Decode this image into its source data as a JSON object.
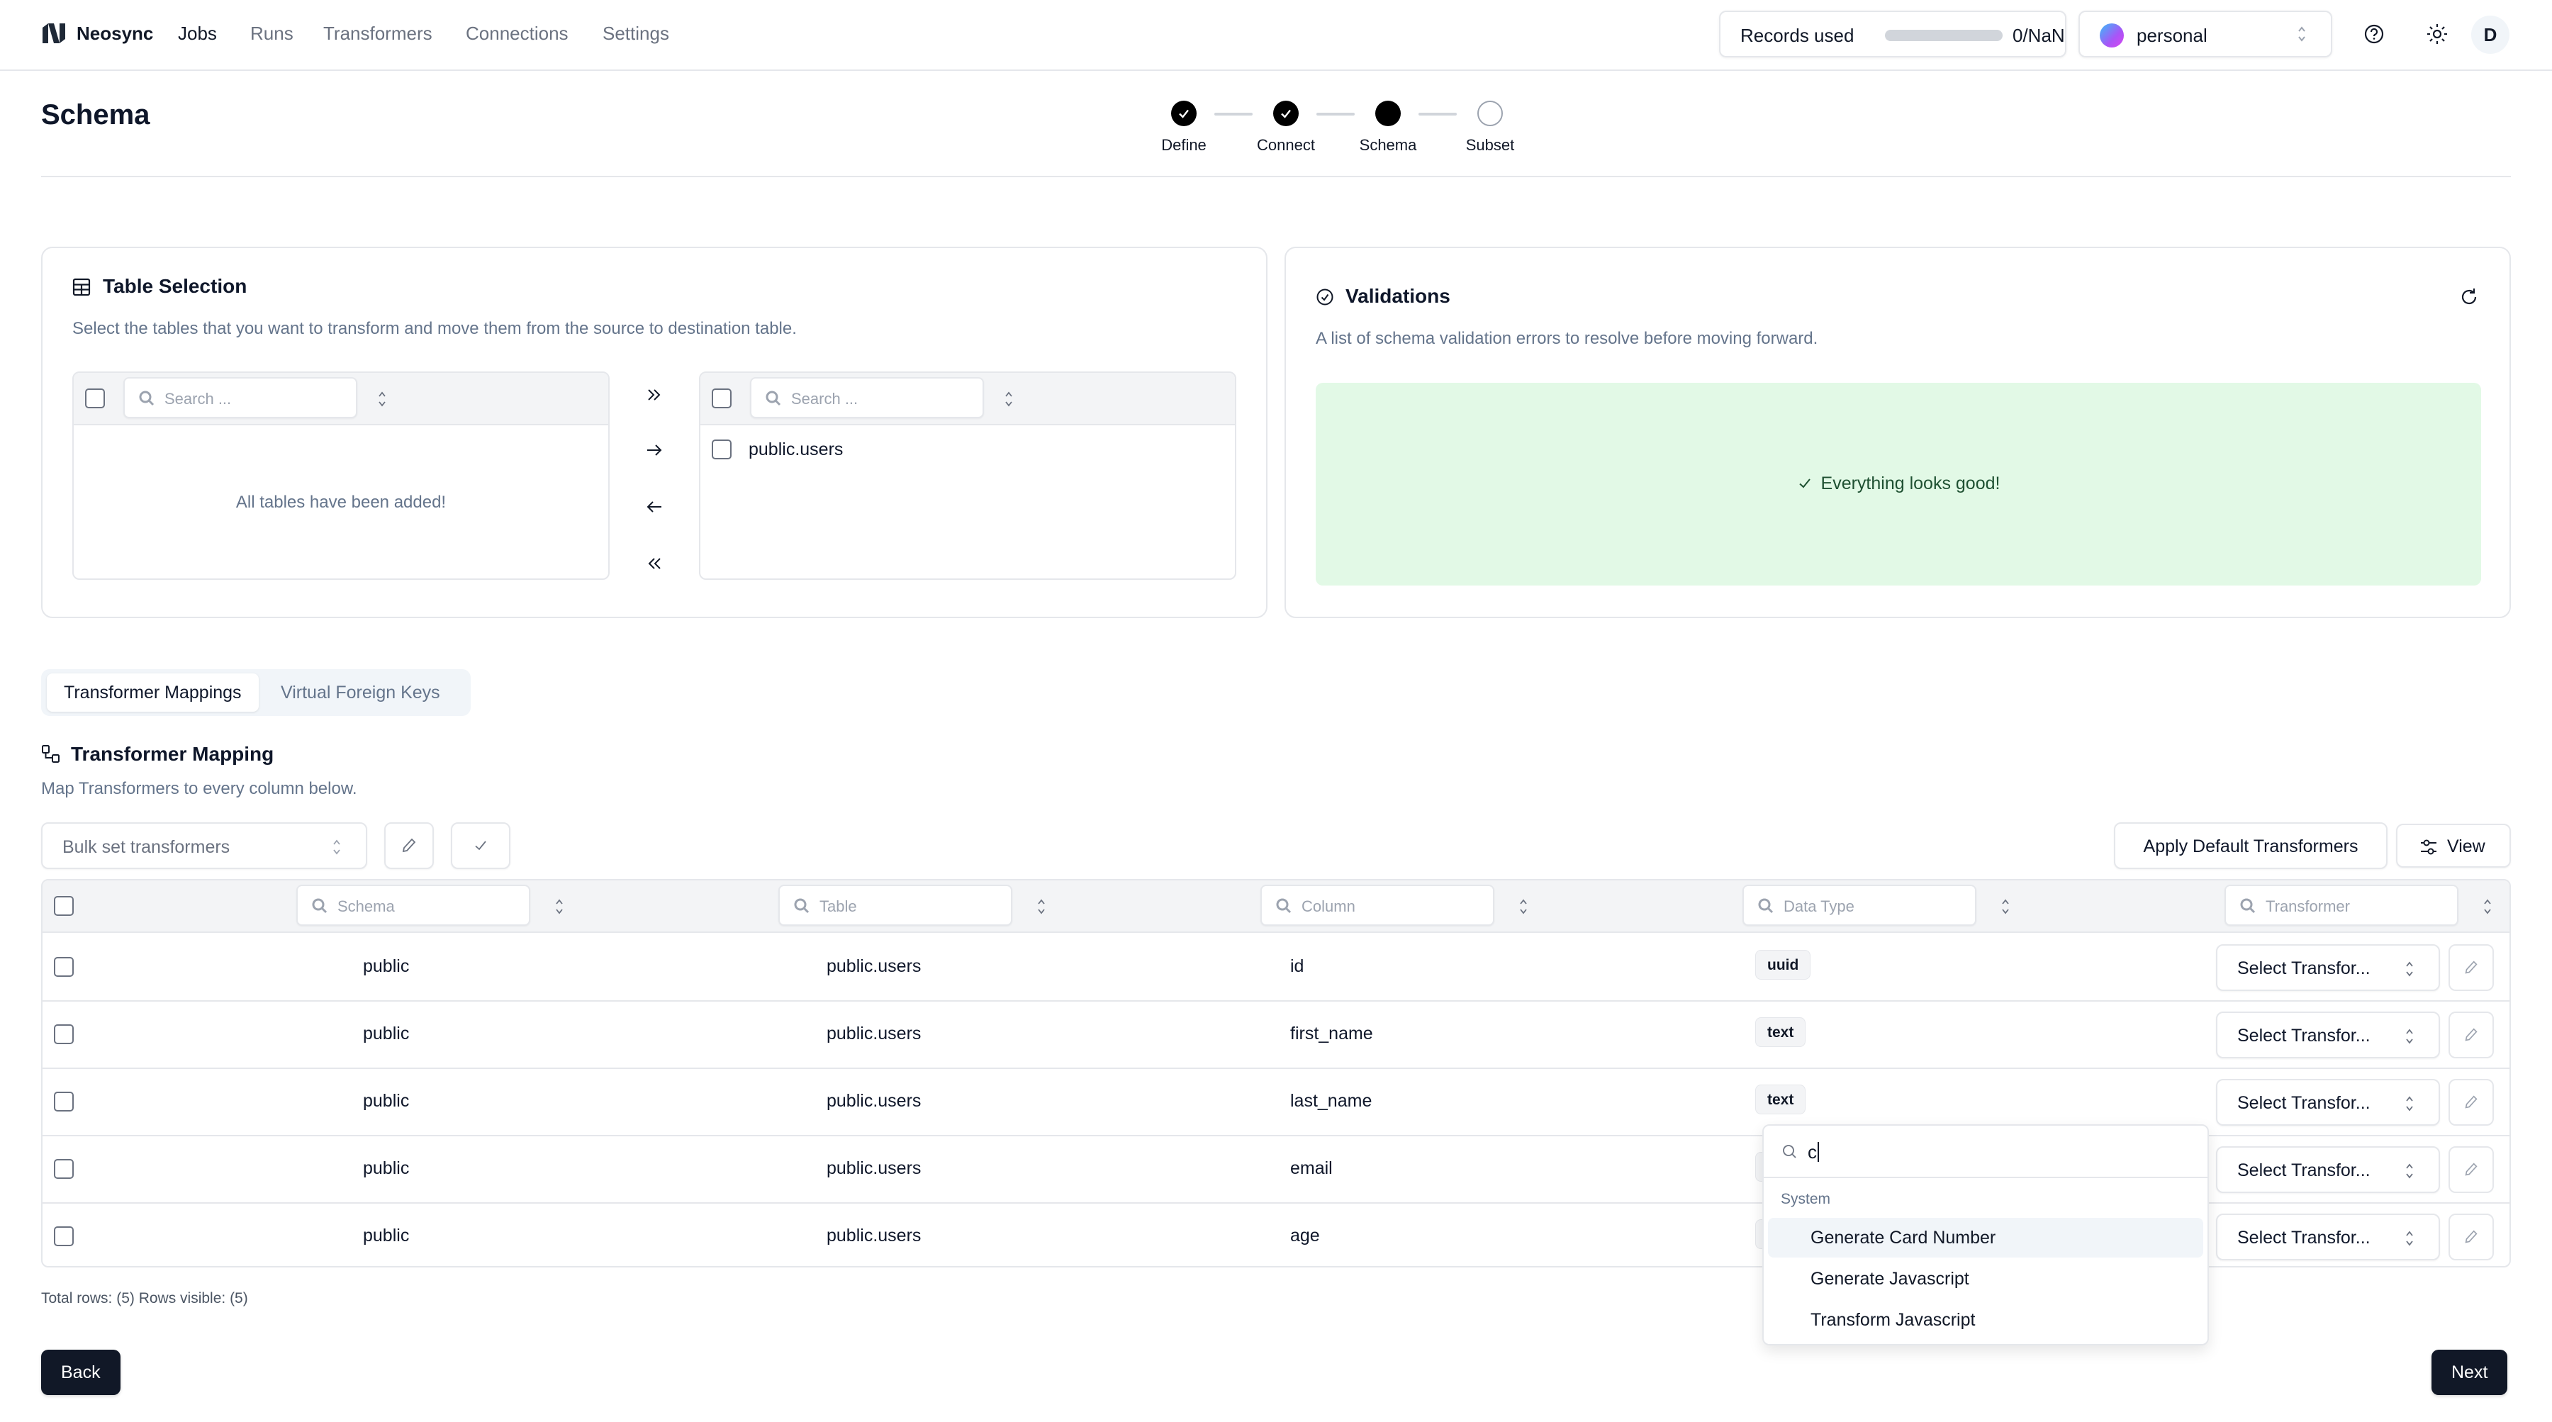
{
  "nav": {
    "brand": "Neosync",
    "links": [
      {
        "label": "Jobs",
        "active": true
      },
      {
        "label": "Runs",
        "active": false
      },
      {
        "label": "Transformers",
        "active": false
      },
      {
        "label": "Connections",
        "active": false
      },
      {
        "label": "Settings",
        "active": false
      }
    ],
    "records": {
      "label": "Records used",
      "value": "0/NaN",
      "progress": 0
    },
    "account": {
      "name": "personal"
    },
    "avatar": "D"
  },
  "page": {
    "title": "Schema",
    "steps": [
      {
        "label": "Define",
        "state": "done"
      },
      {
        "label": "Connect",
        "state": "done"
      },
      {
        "label": "Schema",
        "state": "current"
      },
      {
        "label": "Subset",
        "state": "pending"
      }
    ]
  },
  "table_selection": {
    "title": "Table Selection",
    "description": "Select the tables that you want to transform and move them from the source to destination table.",
    "source": {
      "search_placeholder": "Search ...",
      "empty_message": "All tables have been added!"
    },
    "destination": {
      "search_placeholder": "Search ...",
      "items": [
        "public.users"
      ]
    }
  },
  "validations": {
    "title": "Validations",
    "description": "A list of schema validation errors to resolve before moving forward.",
    "status_message": "Everything looks good!",
    "colors": {
      "success_bg": "#e2f9e6",
      "success_text": "#1f5132"
    }
  },
  "tabs": [
    {
      "label": "Transformer Mappings",
      "active": true
    },
    {
      "label": "Virtual Foreign Keys",
      "active": false
    }
  ],
  "mapping": {
    "title": "Transformer Mapping",
    "description": "Map Transformers to every column below.",
    "bulk_placeholder": "Bulk set transformers",
    "apply_default_label": "Apply Default Transformers",
    "view_label": "View",
    "columns": [
      {
        "placeholder": "Schema"
      },
      {
        "placeholder": "Table"
      },
      {
        "placeholder": "Column"
      },
      {
        "placeholder": "Data Type"
      },
      {
        "placeholder": "Transformer"
      }
    ],
    "rows": [
      {
        "schema": "public",
        "table": "public.users",
        "column": "id",
        "data_type": "uuid",
        "transformer": "Select Transfor..."
      },
      {
        "schema": "public",
        "table": "public.users",
        "column": "first_name",
        "data_type": "text",
        "transformer": "Select Transfor..."
      },
      {
        "schema": "public",
        "table": "public.users",
        "column": "last_name",
        "data_type": "text",
        "transformer": "Select Transfor..."
      },
      {
        "schema": "public",
        "table": "public.users",
        "column": "email",
        "data_type": "",
        "transformer": "Select Transfor..."
      },
      {
        "schema": "public",
        "table": "public.users",
        "column": "age",
        "data_type": "",
        "transformer": "Select Transfor..."
      }
    ],
    "footer": "Total rows: (5) Rows visible: (5)"
  },
  "dropdown": {
    "search_value": "c",
    "group_label": "System",
    "options": [
      {
        "label": "Generate Card Number",
        "highlighted": true
      },
      {
        "label": "Generate Javascript",
        "highlighted": false
      },
      {
        "label": "Transform Javascript",
        "highlighted": false
      }
    ]
  },
  "actions": {
    "back_label": "Back",
    "next_label": "Next"
  }
}
